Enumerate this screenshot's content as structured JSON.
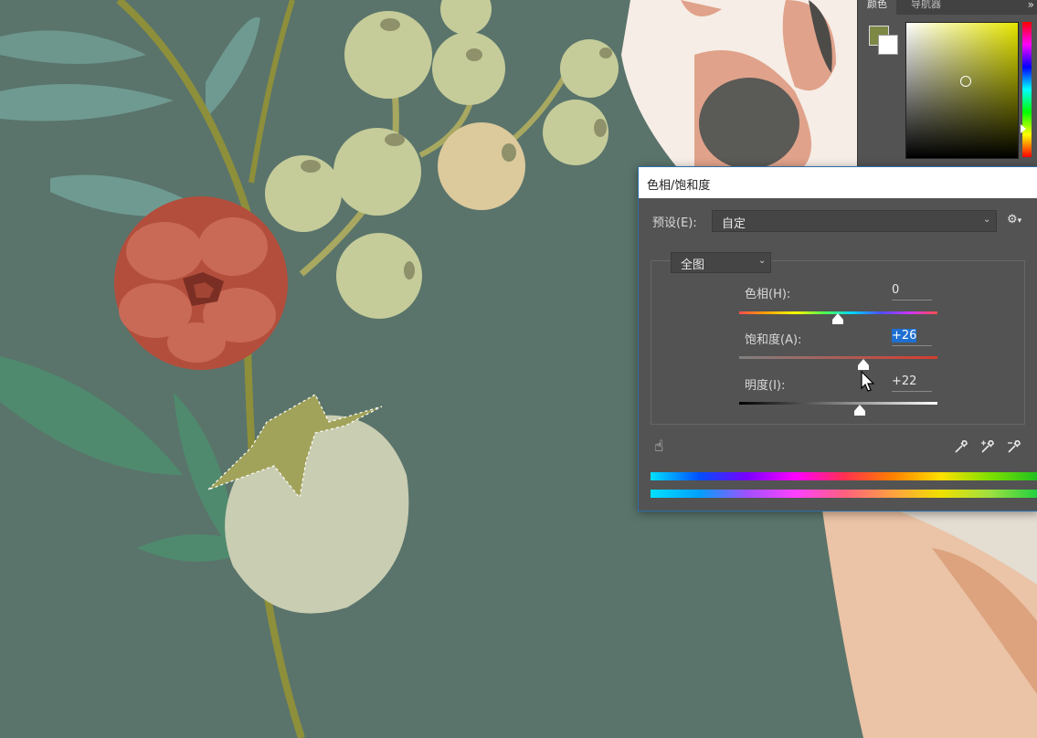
{
  "color_panel": {
    "tab_color": "颜色",
    "tab_navigator": "导航器",
    "menu": "»",
    "foreground_color": "#7d8845"
  },
  "dialog": {
    "title": "色相/饱和度",
    "preset_label": "预设(E):",
    "preset_value": "自定",
    "channel_value": "全图",
    "hue_label": "色相(H):",
    "hue_value": "0",
    "saturation_label": "饱和度(A):",
    "saturation_value": "+26",
    "lightness_label": "明度(I):",
    "lightness_value": "+22",
    "gear": "⚙"
  }
}
